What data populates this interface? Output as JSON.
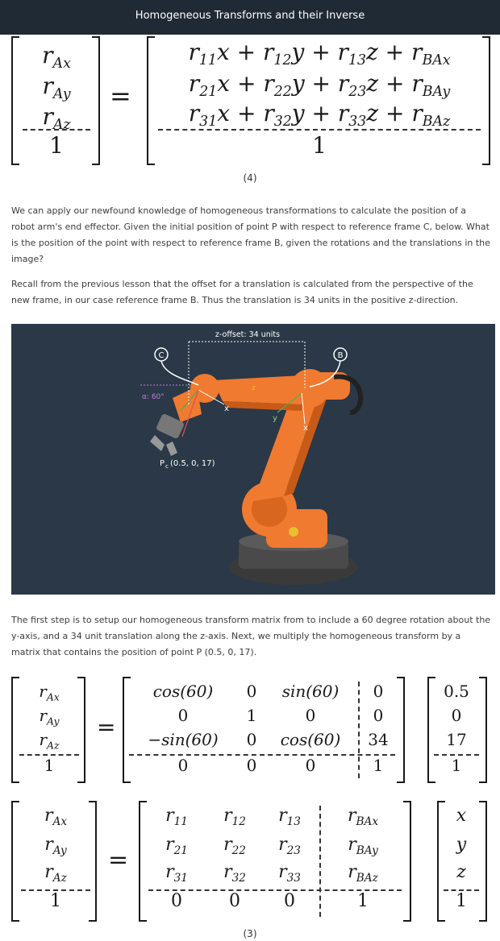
{
  "header": {
    "title": "Homogeneous Transforms and their Inverse"
  },
  "eq4": {
    "lhs": [
      {
        "base": "r",
        "sub": "Ax"
      },
      {
        "base": "r",
        "sub": "Ay"
      },
      {
        "base": "r",
        "sub": "Az"
      },
      {
        "base": "1",
        "sub": ""
      }
    ],
    "rhs": [
      "r₁₁x + r₁₂y + r₁₃z + r_BAx",
      "r₂₁x + r₂₂y + r₂₃z + r_BAy",
      "r₃₁x + r₃₂y + r₃₃z + r_BAz",
      "1"
    ],
    "number": "(4)"
  },
  "paragraphs": {
    "p1": "We can apply our newfound knowledge of homogeneous transformations to calculate the position of a robot arm's end effector. Given the initial position of point P with respect to reference frame C, below. What is the position of the point with respect to reference frame B, given the rotations and the translations in the image?",
    "p2": "Recall from the previous lesson that the offset for a translation is calculated from the perspective of the new frame, in our case reference frame B. Thus the translation is 34 units in the positive z-direction.",
    "p3": "The first step is to setup our homogeneous transform matrix from to include a 60 degree rotation about the y-axis, and a 34 unit translation along the z-axis. Next, we multiply the homogeneous transform by a matrix that contains the position of point P (0.5, 0, 17)."
  },
  "figure": {
    "z_offset_label": "z-offset: 34 units",
    "frame_c": "C",
    "frame_b": "B",
    "alpha_label": "α: 60°",
    "point_label": "P",
    "point_sub": "c",
    "point_coords": "(0.5, 0, 17)",
    "axis_x": "x",
    "axis_y": "y",
    "axis_z": "z",
    "colors": {
      "background": "#2a3847",
      "robot": "#f07a2f",
      "robot_dark": "#c85a18",
      "base": "#3a3a3a"
    }
  },
  "eq_numeric": {
    "lhs": [
      "r_Ax",
      "r_Ay",
      "r_Az",
      "1"
    ],
    "transform": [
      [
        "cos(60)",
        "0",
        "sin(60)",
        "0"
      ],
      [
        "0",
        "1",
        "0",
        "0"
      ],
      [
        "−sin(60)",
        "0",
        "cos(60)",
        "34"
      ],
      [
        "0",
        "0",
        "0",
        "1"
      ]
    ],
    "point": [
      "0.5",
      "0",
      "17",
      "1"
    ]
  },
  "eq3": {
    "lhs": [
      "r_Ax",
      "r_Ay",
      "r_Az",
      "1"
    ],
    "transform": [
      [
        "r₁₁",
        "r₁₂",
        "r₁₃",
        "r_BAx"
      ],
      [
        "r₂₁",
        "r₂₂",
        "r₂₃",
        "r_BAy"
      ],
      [
        "r₃₁",
        "r₃₂",
        "r₃₃",
        "r_BAz"
      ],
      [
        "0",
        "0",
        "0",
        "1"
      ]
    ],
    "vector": [
      "x",
      "y",
      "z",
      "1"
    ],
    "number": "(3)"
  }
}
